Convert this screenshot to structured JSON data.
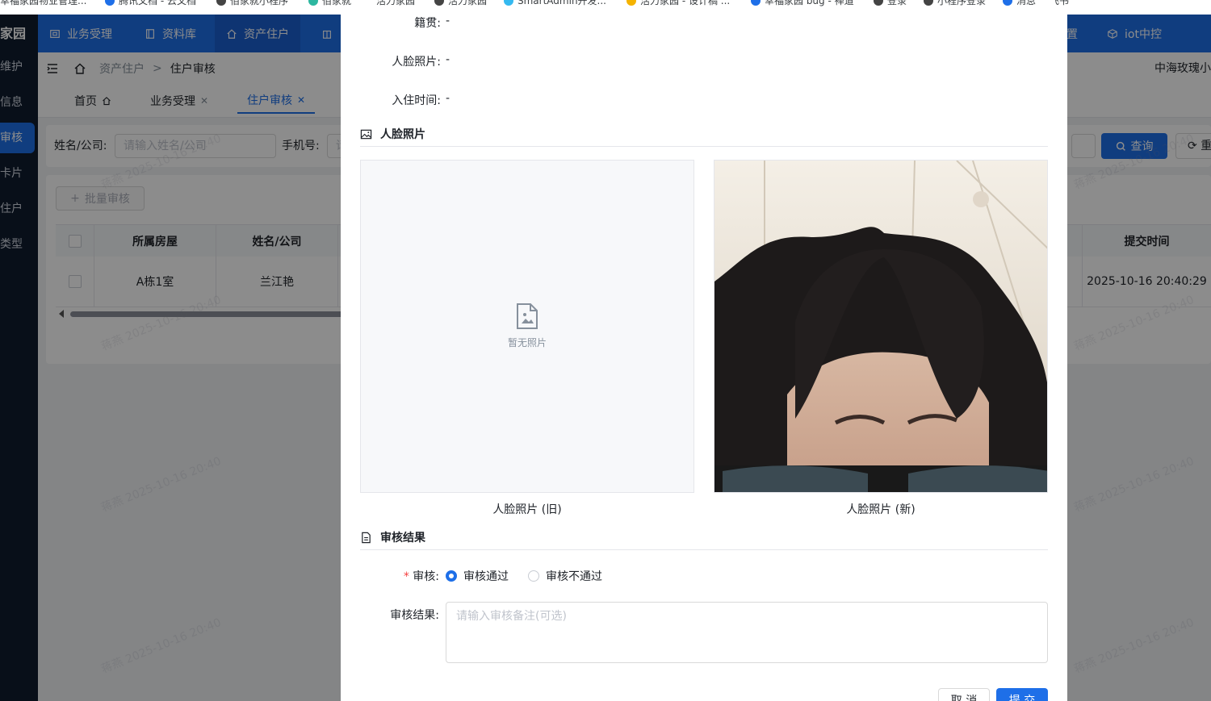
{
  "bookmarks": [
    "幸福家园物业管理...",
    "腾讯文档 - 云文档",
    "佰家就小程序",
    "佰家就",
    "活力家园",
    "SmartAdmin开发...",
    "活力家园 - 设计稿 ...",
    "幸福家园 bug - 禅道",
    "登录",
    "小程序登录",
    "消息",
    "飞书"
  ],
  "sidebar": {
    "logo": "家园",
    "items": [
      {
        "label": "维护"
      },
      {
        "label": "信息"
      },
      {
        "label": "审核"
      },
      {
        "label": "卡片"
      },
      {
        "label": "住户"
      },
      {
        "label": "类型"
      }
    ]
  },
  "topnav": {
    "items": [
      {
        "label": "业务受理"
      },
      {
        "label": "资料库"
      },
      {
        "label": "资产住户"
      },
      {
        "label": "置"
      },
      {
        "label": "iot中控"
      }
    ]
  },
  "breadcrumb": {
    "parent": "资产住户",
    "separator": ">",
    "current": "住户审核",
    "project": "中海玫瑰小"
  },
  "tabs": [
    {
      "label": "首页"
    },
    {
      "label": "业务受理"
    },
    {
      "label": "住户审核"
    }
  ],
  "search": {
    "name_label": "姓名/公司:",
    "name_placeholder": "请输入姓名/公司",
    "phone_label": "手机号:",
    "phone_placeholder": "请",
    "query_label": "查询",
    "reset_label": "重"
  },
  "table": {
    "batch_label": "批量审核",
    "columns": [
      "所属房屋",
      "姓名/公司",
      "提交时间"
    ],
    "rows": [
      {
        "house": "A栋1室",
        "name": "兰江艳",
        "time": "2025-10-16 20:40:29"
      }
    ]
  },
  "watermark": "蒋燕 2025-10-16 20:40",
  "modal": {
    "fields": [
      {
        "label": "籍贯:",
        "value": "-"
      },
      {
        "label": "人脸照片:",
        "value": "-"
      },
      {
        "label": "入住时间:",
        "value": "-"
      }
    ],
    "face_section_title": "人脸照片",
    "empty_photo_text": "暂无照片",
    "old_caption": "人脸照片 (旧)",
    "new_caption": "人脸照片 (新)",
    "result_section_title": "审核结果",
    "audit_label": "审核:",
    "required_mark": "*",
    "options": [
      {
        "label": "审核通过",
        "checked": true
      },
      {
        "label": "审核不通过",
        "checked": false
      }
    ],
    "remark_label": "审核结果:",
    "remark_placeholder": "请输入审核备注(可选)",
    "cancel_label": "取 消",
    "submit_label": "提 交"
  },
  "colors": {
    "primary": "#1e6fe8",
    "sidebar": "#0f1c2e",
    "mask": "rgba(0,0,0,0.45)"
  }
}
